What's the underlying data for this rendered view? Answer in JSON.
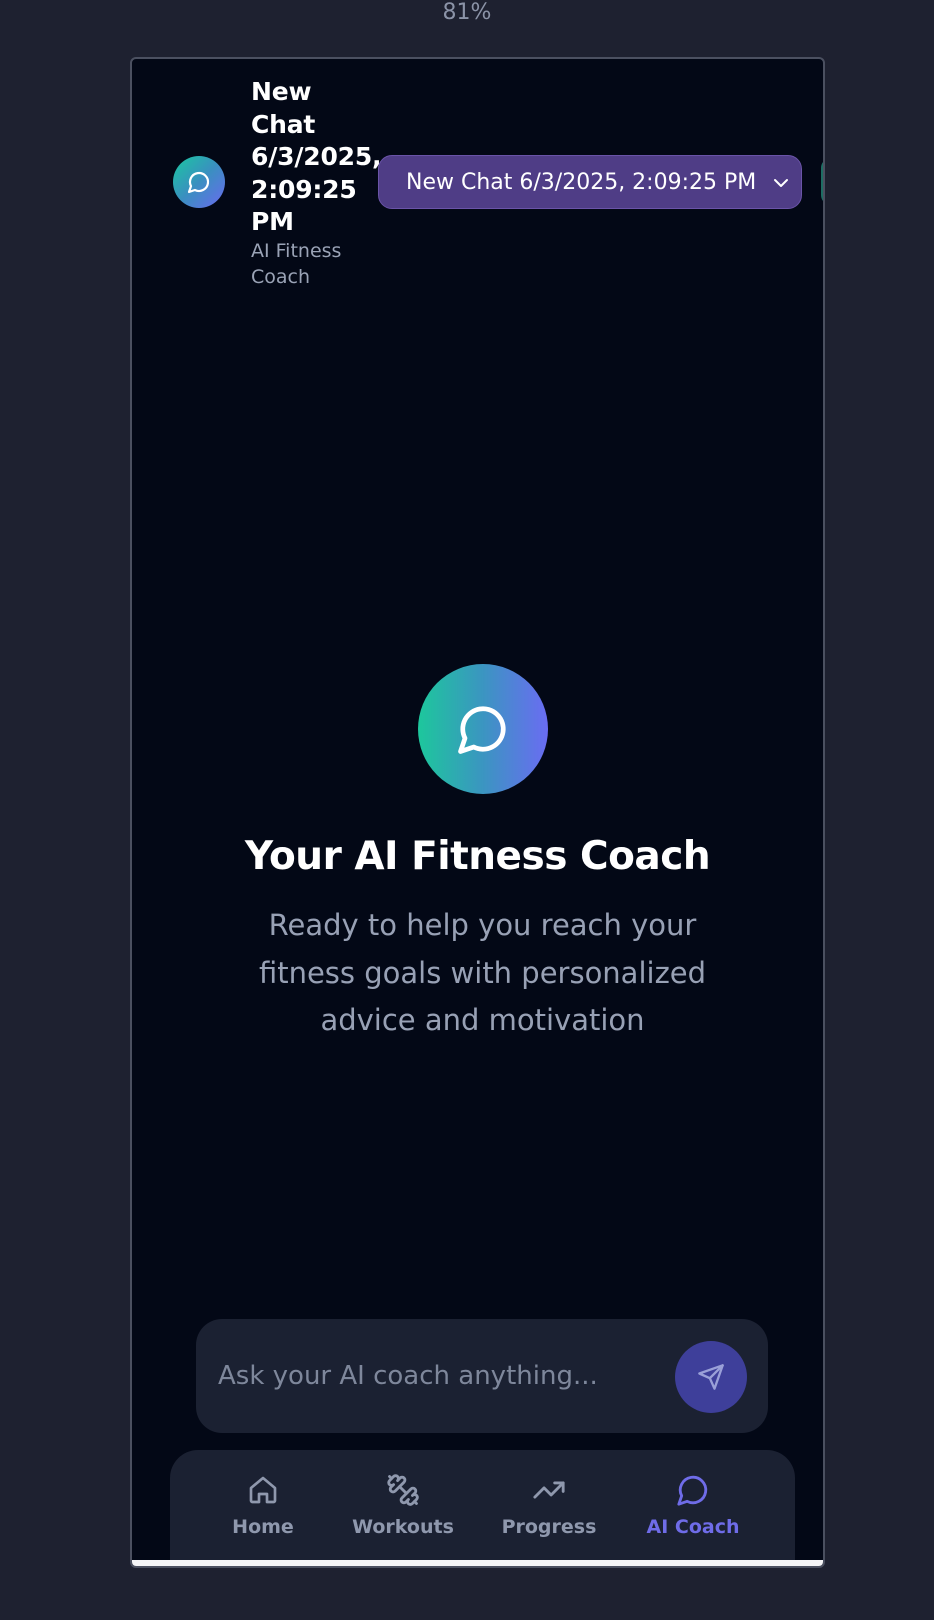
{
  "zoom_level": "81%",
  "header": {
    "title": "New Chat 6/3/2025, 2:09:25 PM",
    "subtitle": "AI Fitness Coach",
    "chat_select_value": "New Chat 6/3/2025, 2:09:25 PM"
  },
  "hero": {
    "title": "Your AI Fitness Coach",
    "description": "Ready to help you reach your fitness goals with personalized advice and motivation"
  },
  "composer": {
    "placeholder": "Ask your AI coach anything..."
  },
  "nav": {
    "items": [
      {
        "label": "Home",
        "icon": "home-icon",
        "active": false
      },
      {
        "label": "Workouts",
        "icon": "dumbbell-icon",
        "active": false
      },
      {
        "label": "Progress",
        "icon": "trending-up-icon",
        "active": false
      },
      {
        "label": "AI Coach",
        "icon": "chat-bubble-icon",
        "active": true
      }
    ]
  },
  "colors": {
    "background": "#1e2130",
    "app_background": "#030816",
    "accent_purple": "#4f3d86",
    "active_nav": "#6f6ce8",
    "gradient_start": "#1dc79c",
    "gradient_end": "#6a6cf2"
  }
}
